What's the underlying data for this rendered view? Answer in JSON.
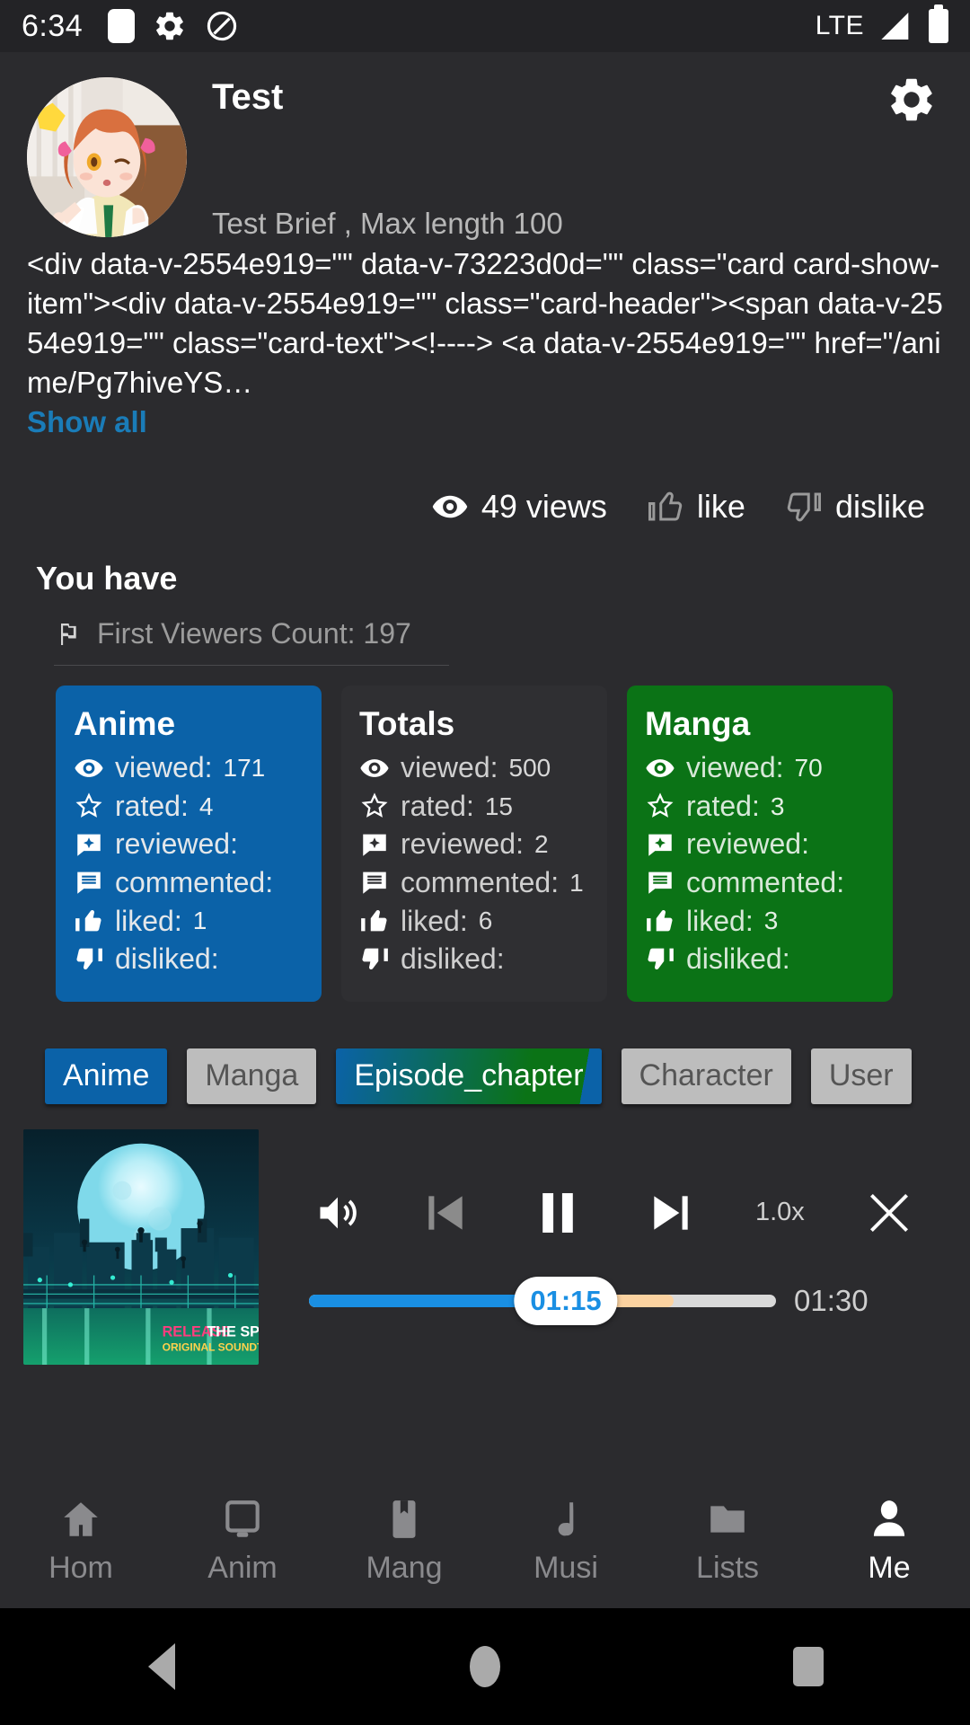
{
  "status_bar": {
    "clock": "6:34",
    "network": "LTE",
    "icons": [
      "square-app-icon",
      "gear-icon",
      "do-not-disturb-icon"
    ],
    "signal_icon": "signal-bars-icon",
    "battery_icon": "battery-full-icon"
  },
  "profile": {
    "name": "Test",
    "brief": "Test Brief , Max length 100",
    "settings_icon": "gear-icon",
    "avatar_alt": "anime-girl-avatar"
  },
  "description": {
    "code_text": "<div data-v-2554e919=\"\" data-v-73223d0d=\"\" class=\"card card-show-item\"><div data-v-2554e919=\"\" class=\"card-header\"><span data-v-2554e919=\"\" class=\"card-text\"><!----> <a data-v-2554e919=\"\" href=\"/anime/Pg7hiveYS…",
    "show_all_label": "Show all",
    "show_all_color": "#1a7cb8"
  },
  "engagement": {
    "views_count": "49",
    "views_label": "49 views",
    "views_icon": "eye-icon",
    "like_label": "like",
    "like_icon": "thumb-up-icon",
    "dislike_label": "dislike",
    "dislike_icon": "thumb-down-icon"
  },
  "you_have": {
    "heading": "You have",
    "first_viewers_label": "First Viewers Count: 197",
    "flag_icon": "flag-icon"
  },
  "stat_cards": [
    {
      "id": "anime",
      "title": "Anime",
      "accent": "#0b62a8",
      "rows": [
        {
          "icon": "eye-icon",
          "label": "viewed:",
          "value": "171"
        },
        {
          "icon": "star-icon",
          "label": "rated:",
          "value": "4"
        },
        {
          "icon": "review-icon",
          "label": "reviewed:",
          "value": ""
        },
        {
          "icon": "comment-icon",
          "label": "commented:",
          "value": ""
        },
        {
          "icon": "thumb-up-icon",
          "label": "liked:",
          "value": "1"
        },
        {
          "icon": "thumb-down-icon",
          "label": "disliked:",
          "value": ""
        }
      ]
    },
    {
      "id": "totals",
      "title": "Totals",
      "accent": "#2f2f32",
      "rows": [
        {
          "icon": "eye-icon",
          "label": "viewed:",
          "value": "500"
        },
        {
          "icon": "star-icon",
          "label": "rated:",
          "value": "15"
        },
        {
          "icon": "review-icon",
          "label": "reviewed:",
          "value": "2"
        },
        {
          "icon": "comment-icon",
          "label": "commented:",
          "value": "1"
        },
        {
          "icon": "thumb-up-icon",
          "label": "liked:",
          "value": "6"
        },
        {
          "icon": "thumb-down-icon",
          "label": "disliked:",
          "value": ""
        }
      ]
    },
    {
      "id": "manga",
      "title": "Manga",
      "accent": "#0b7316",
      "rows": [
        {
          "icon": "eye-icon",
          "label": "viewed:",
          "value": "70"
        },
        {
          "icon": "star-icon",
          "label": "rated:",
          "value": "3"
        },
        {
          "icon": "review-icon",
          "label": "reviewed:",
          "value": ""
        },
        {
          "icon": "comment-icon",
          "label": "commented:",
          "value": ""
        },
        {
          "icon": "thumb-up-icon",
          "label": "liked:",
          "value": "3"
        },
        {
          "icon": "thumb-down-icon",
          "label": "disliked:",
          "value": ""
        }
      ]
    }
  ],
  "chips": [
    {
      "label": "Anime",
      "style": "sel-blue"
    },
    {
      "label": "Manga",
      "style": "grey"
    },
    {
      "label": "Episode_chapter",
      "style": "grad"
    },
    {
      "label": "Character",
      "style": "grey"
    },
    {
      "label": "User",
      "style": "grey"
    }
  ],
  "player": {
    "album_title": "RELEASE THE SPYCE",
    "album_subtitle": "ORIGINAL SOUNDTRACK",
    "volume_icon": "volume-icon",
    "prev_icon": "previous-track-icon",
    "play_pause_icon": "pause-icon",
    "next_icon": "next-track-icon",
    "speed_label": "1.0x",
    "close_icon": "close-icon",
    "current_time": "01:15",
    "total_time": "01:30",
    "played_percent": 55,
    "buffered_percent": 78,
    "played_color": "#1a8fe3",
    "buffered_color": "#fbd2a0"
  },
  "bottom_nav": [
    {
      "label": "Hom",
      "icon": "home-icon",
      "active": false
    },
    {
      "label": "Anim",
      "icon": "tv-icon",
      "active": false
    },
    {
      "label": "Mang",
      "icon": "bookmark-icon",
      "active": false
    },
    {
      "label": "Musi",
      "icon": "music-note-icon",
      "active": false
    },
    {
      "label": "Lists",
      "icon": "folder-icon",
      "active": false
    },
    {
      "label": "Me",
      "icon": "person-icon",
      "active": true
    }
  ],
  "android_nav": {
    "back_icon": "back-triangle-icon",
    "home_icon": "home-circle-icon",
    "recents_icon": "recents-square-icon"
  }
}
